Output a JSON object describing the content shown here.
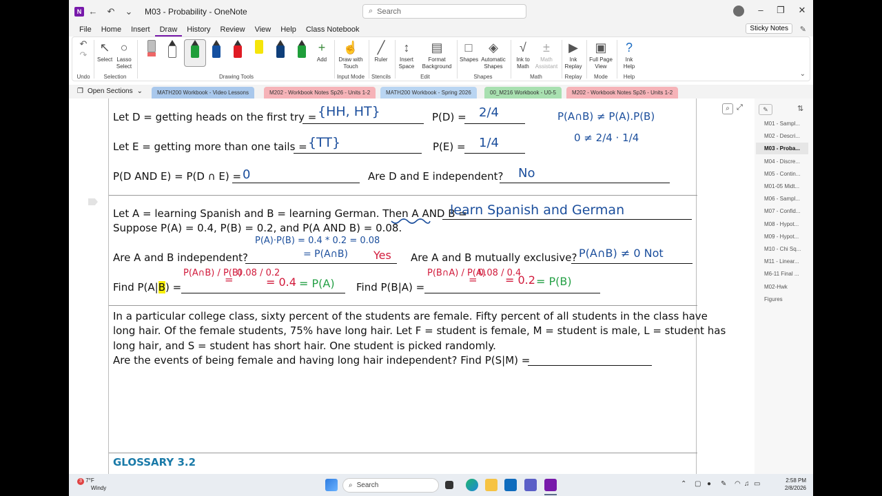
{
  "window": {
    "title": "M03 - Probability  -  OneNote",
    "search_placeholder": "Search"
  },
  "menu": [
    "File",
    "Home",
    "Insert",
    "Draw",
    "History",
    "Review",
    "View",
    "Help",
    "Class Notebook"
  ],
  "menu_active": "Draw",
  "sticky_notes": "Sticky Notes",
  "ribbon": {
    "undo": "Undo",
    "select": "Select",
    "lasso": "Lasso Select",
    "selection_group": "Selection",
    "drawing_tools_group": "Drawing Tools",
    "add": "Add",
    "draw_with_touch": "Draw with Touch",
    "input_mode_group": "Input Mode",
    "ruler": "Ruler",
    "stencils_group": "Stencils",
    "insert_space": "Insert Space",
    "format_background": "Format Background",
    "edit_group": "Edit",
    "shapes": "Shapes",
    "automatic_shapes": "Automatic Shapes",
    "shapes_group": "Shapes",
    "ink_to_math": "Ink to Math",
    "math_assistant": "Math Assistant",
    "math_group": "Math",
    "ink_replay": "Ink Replay",
    "replay_group": "Replay",
    "full_page_view": "Full Page View",
    "mode_group": "Mode",
    "ink_help": "Ink Help",
    "help_group": "Help",
    "pen_colors": [
      "#bfbfbf",
      "#ffffff",
      "#1f9e3a",
      "#1450a0",
      "#e01b24",
      "#f5e50a",
      "#0f3f7a",
      "#1f9e3a"
    ]
  },
  "open_sections": "Open Sections",
  "section_tabs": [
    {
      "label": "MATH200 Workbook - Video Lessons",
      "color": "#a9c8ec",
      "active": true
    },
    {
      "label": "M202 - Workbook Notes Sp26 - Units 1-2",
      "color": "#f6b3b8"
    },
    {
      "label": "MATH200 Workbook - Spring 2026",
      "color": "#b9d5f2"
    },
    {
      "label": "00_M216 Workbook - U0-5",
      "color": "#a8e0b0"
    },
    {
      "label": "M202 - Workbook Notes Sp26 - Units 1-2",
      "color": "#f6b3b8"
    }
  ],
  "worksheet": {
    "q1_d": "Let D = getting heads on the first try =",
    "q1_pd": "P(D) =",
    "q1_e": "Let E = getting more than one tails =",
    "q1_pe": "P(E) =",
    "q1_and": "P(D AND E) = P(D ∩ E) =",
    "q1_indep": "Are D and E independent?",
    "q2_line1": "Let A = learning Spanish and B = learning German. Then A AND B =",
    "q2_line2": "Suppose P(A) = 0.4, P(B) = 0.2, and P(A AND B) = 0.08.",
    "q2_indep": "Are A and B independent?",
    "q2_mutex": "Are A and B mutually exclusive?",
    "q2_find_a": "Find P(A|",
    "q2_find_b": "B",
    "q2_find_c": ") =",
    "q2_find2": "Find P(B|A) =",
    "q3_p1": "In a particular college class, sixty percent of the students are female. Fifty percent of all students in the class have",
    "q3_p2": "long hair. Of the female students, 75% have long hair. Let F = student is female, M = student is male, L = student has",
    "q3_p3": "long hair, and S = student has short hair. One student is picked randomly.",
    "q3_p4": "Are the events of being female and having long hair independent?   Find P(S|M) =",
    "glossary": "GLOSSARY 3.2"
  },
  "ink": {
    "d_set": "{HH, HT}",
    "pd": "2/4",
    "e_set": "{TT}",
    "pe": "1/4",
    "pde": "0",
    "de_indep": "No",
    "side_l1": "P(A∩B) ≠ P(A).P(B)",
    "side_l2": "0  ≠  2/4 · 1/4",
    "ab_words": "learn Spanish and German",
    "calc1": "P(A)·P(B) = 0.4 * 0.2 = 0.08",
    "calc2": "= P(A∩B)",
    "yes": "Yes",
    "mutex": "P(A∩B) ≠ 0   Not",
    "find1_frac": "P(A∩B) / P(B)",
    "find1_eq": "=",
    "find1_val": "0.08 / 0.2",
    "find1_res": "= 0.4",
    "find1_pa": "= P(A)",
    "find2_frac": "P(B∩A) / P(A)",
    "find2_eq": "=",
    "find2_val": "0.08 / 0.4",
    "find2_res": "= 0.2",
    "find2_pb": "= P(B)"
  },
  "pages": [
    "M01 - Sampl...",
    "M02 - Descri...",
    "M03 - Proba...",
    "M04 - Discre...",
    "M05 - Contin...",
    "M01-05 Midt...",
    "M06 - Sampl...",
    "M07 - Confid...",
    "M08 - Hypot...",
    "M09 - Hypot...",
    "M10 - Chi Sq...",
    "M11 - Linear...",
    "M6-11 Final ...",
    "M02-Hwk",
    "Figures"
  ],
  "selected_page": "M03 - Proba...",
  "taskbar": {
    "weather_temp": "7°F",
    "weather_desc": "Windy",
    "weather_badge": "3",
    "search": "Search",
    "time": "2:58 PM",
    "date": "2/8/2026"
  }
}
